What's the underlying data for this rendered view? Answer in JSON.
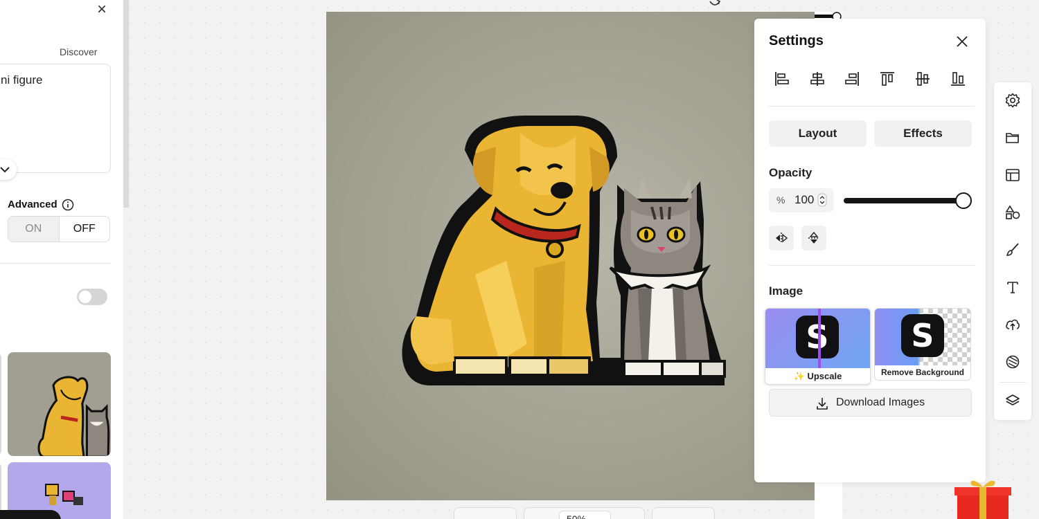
{
  "left_panel": {
    "discover_label": "Discover",
    "prompt_text": "ni figure",
    "advanced_label": "Advanced",
    "toggle_on_label": "ON",
    "toggle_off_label": "OFF"
  },
  "canvas": {
    "zoom": "50%"
  },
  "settings": {
    "title": "Settings",
    "align_tools": [
      "align-left-icon",
      "align-center-horizontal-icon",
      "align-right-icon",
      "align-top-icon",
      "align-middle-vertical-icon",
      "align-bottom-icon"
    ],
    "tabs": [
      {
        "label": "Layout"
      },
      {
        "label": "Effects"
      }
    ],
    "opacity_label": "Opacity",
    "opacity_unit": "%",
    "opacity_value": "100",
    "opacity_fraction": 1.0,
    "image_label": "Image",
    "upscale_label": "✨ Upscale",
    "remove_bg_label": "Remove Background",
    "download_label": "Download Images"
  },
  "right_toolbar": {
    "icons": [
      "settings-icon",
      "folder-icon",
      "layout-template-icon",
      "shapes-icon",
      "brush-icon",
      "text-icon",
      "upload-cloud-icon",
      "sticker-icon",
      "layers-icon"
    ]
  },
  "colors": {
    "accent": "#161616",
    "canvas_bg": "#a7a596",
    "dog": "#e9b532",
    "cat": "#8d877f"
  }
}
